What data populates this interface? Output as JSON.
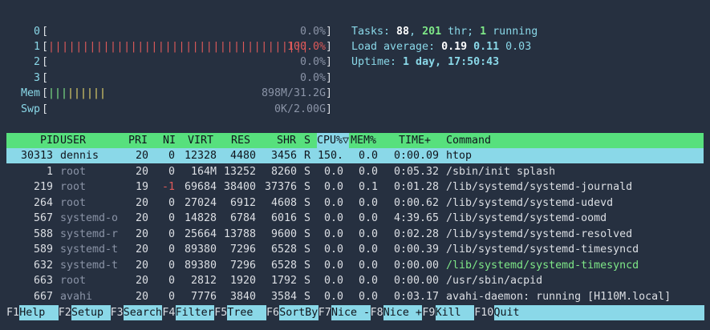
{
  "meters": {
    "cpu": [
      {
        "label": "0",
        "pct": "0.0%",
        "bar": "",
        "color": "green"
      },
      {
        "label": "1",
        "pct": "100.0%",
        "bar": "||||||||||||||||||||||||||||||||||||||",
        "color": "red"
      },
      {
        "label": "2",
        "pct": "0.0%",
        "bar": "",
        "color": "green"
      },
      {
        "label": "3",
        "pct": "0.0%",
        "bar": "",
        "color": "green"
      }
    ],
    "mem": {
      "label": "Mem",
      "bar_green": "|||",
      "bar_yellow": "||||||",
      "value": "898M/31.2G"
    },
    "swp": {
      "label": "Swp",
      "value": "0K/2.00G"
    }
  },
  "summary": {
    "tasks_label": "Tasks: ",
    "tasks": "88",
    "sep1": ", ",
    "thr": "201",
    "thr_label": " thr; ",
    "running": "1",
    "running_label": " running",
    "load_label": "Load average: ",
    "load1": "0.19",
    "load5": "0.11",
    "load15": "0.03",
    "uptime_label": "Uptime: ",
    "uptime": "1 day, 17:50:43"
  },
  "columns": {
    "pid": "PID",
    "user": "USER",
    "pri": "PRI",
    "ni": "NI",
    "virt": "VIRT",
    "res": "RES",
    "shr": "SHR",
    "s": "S",
    "cpu": "CPU%▽",
    "mem": "MEM%",
    "time": "TIME+",
    "command": "Command"
  },
  "processes": [
    {
      "pid": "30313",
      "user": "dennis",
      "pri": "20",
      "ni": "0",
      "virt": "12328",
      "res": "4480",
      "shr": "3456",
      "s": "R",
      "cpu": "150.",
      "mem": "0.0",
      "time": "0:00.09",
      "command": "htop",
      "selected": true
    },
    {
      "pid": "1",
      "user": "root",
      "pri": "20",
      "ni": "0",
      "virt": "164M",
      "res": "13252",
      "shr": "8260",
      "s": "S",
      "cpu": "0.0",
      "mem": "0.0",
      "time": "0:05.32",
      "command": "/sbin/init splash"
    },
    {
      "pid": "219",
      "user": "root",
      "pri": "19",
      "ni": "-1",
      "virt": "69684",
      "res": "38400",
      "shr": "37376",
      "s": "S",
      "cpu": "0.0",
      "mem": "0.1",
      "time": "0:01.28",
      "command": "/lib/systemd/systemd-journald"
    },
    {
      "pid": "264",
      "user": "root",
      "pri": "20",
      "ni": "0",
      "virt": "27024",
      "res": "6912",
      "shr": "4608",
      "s": "S",
      "cpu": "0.0",
      "mem": "0.0",
      "time": "0:00.62",
      "command": "/lib/systemd/systemd-udevd"
    },
    {
      "pid": "567",
      "user": "systemd-o",
      "pri": "20",
      "ni": "0",
      "virt": "14828",
      "res": "6784",
      "shr": "6016",
      "s": "S",
      "cpu": "0.0",
      "mem": "0.0",
      "time": "4:39.65",
      "command": "/lib/systemd/systemd-oomd"
    },
    {
      "pid": "588",
      "user": "systemd-r",
      "pri": "20",
      "ni": "0",
      "virt": "25664",
      "res": "13788",
      "shr": "9600",
      "s": "S",
      "cpu": "0.0",
      "mem": "0.0",
      "time": "0:02.28",
      "command": "/lib/systemd/systemd-resolved"
    },
    {
      "pid": "589",
      "user": "systemd-t",
      "pri": "20",
      "ni": "0",
      "virt": "89380",
      "res": "7296",
      "shr": "6528",
      "s": "S",
      "cpu": "0.0",
      "mem": "0.0",
      "time": "0:00.39",
      "command": "/lib/systemd/systemd-timesyncd"
    },
    {
      "pid": "632",
      "user": "systemd-t",
      "pri": "20",
      "ni": "0",
      "virt": "89380",
      "res": "7296",
      "shr": "6528",
      "s": "S",
      "cpu": "0.0",
      "mem": "0.0",
      "time": "0:00.00",
      "command": "/lib/systemd/systemd-timesyncd",
      "thread": true
    },
    {
      "pid": "663",
      "user": "root",
      "pri": "20",
      "ni": "0",
      "virt": "2812",
      "res": "1920",
      "shr": "1792",
      "s": "S",
      "cpu": "0.0",
      "mem": "0.0",
      "time": "0:00.00",
      "command": "/usr/sbin/acpid"
    },
    {
      "pid": "667",
      "user": "avahi",
      "pri": "20",
      "ni": "0",
      "virt": "7776",
      "res": "3840",
      "shr": "3584",
      "s": "S",
      "cpu": "0.0",
      "mem": "0.0",
      "time": "0:03.17",
      "command": "avahi-daemon: running [H110M.local]"
    }
  ],
  "footer": [
    {
      "key": "F1",
      "label": "Help  "
    },
    {
      "key": "F2",
      "label": "Setup "
    },
    {
      "key": "F3",
      "label": "Search"
    },
    {
      "key": "F4",
      "label": "Filter"
    },
    {
      "key": "F5",
      "label": "Tree  "
    },
    {
      "key": "F6",
      "label": "SortBy"
    },
    {
      "key": "F7",
      "label": "Nice -"
    },
    {
      "key": "F8",
      "label": "Nice +"
    },
    {
      "key": "F9",
      "label": "Kill  "
    },
    {
      "key": "F10",
      "label": "Quit  "
    }
  ]
}
